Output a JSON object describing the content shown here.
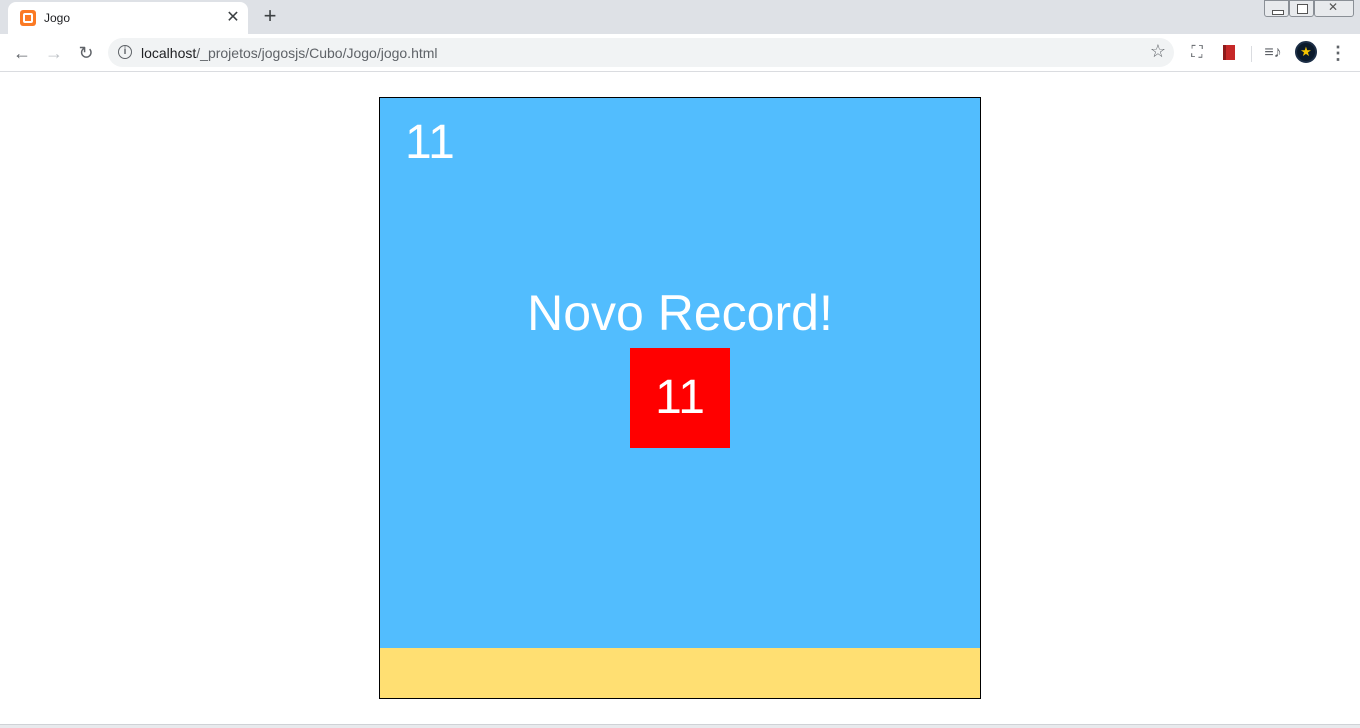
{
  "browser": {
    "tab": {
      "title": "Jogo",
      "close_glyph": "✕",
      "favicon": "xampp-icon"
    },
    "new_tab_glyph": "+",
    "address": {
      "host": "localhost",
      "path": "/_projetos/jogosjs/Cubo/Jogo/jogo.html"
    },
    "icons": {
      "back": "←",
      "forward": "→",
      "reload": "↻",
      "info": "i",
      "star": "☆",
      "screenshot": "⛶",
      "media": "≡♪",
      "avatar": "★",
      "menu": "⋮"
    }
  },
  "game": {
    "score": "11",
    "record_message": "Novo Record!",
    "record_value": "11",
    "colors": {
      "sky": "#52bdfe",
      "ground": "#ffdf72",
      "record_box": "#ff0000",
      "text": "#ffffff"
    }
  }
}
